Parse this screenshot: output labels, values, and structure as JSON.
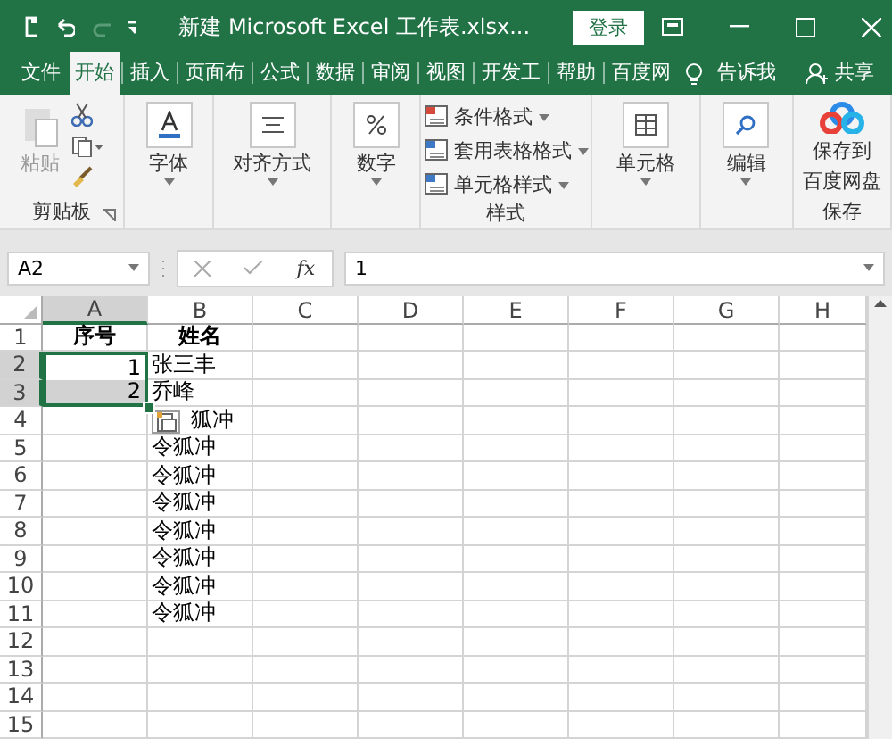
{
  "title_bar": {
    "title": "新建 Microsoft Excel 工作表.xlsx...",
    "login": "登录"
  },
  "tabs": [
    {
      "label": "文件",
      "selected": false
    },
    {
      "label": "开始",
      "selected": true
    },
    {
      "label": "插入",
      "selected": false
    },
    {
      "label": "页面布",
      "selected": false
    },
    {
      "label": "公式",
      "selected": false
    },
    {
      "label": "数据",
      "selected": false
    },
    {
      "label": "审阅",
      "selected": false
    },
    {
      "label": "视图",
      "selected": false
    },
    {
      "label": "开发工",
      "selected": false
    },
    {
      "label": "帮助",
      "selected": false
    },
    {
      "label": "百度网",
      "selected": false
    }
  ],
  "tell_me": "告诉我",
  "share": "共享",
  "ribbon": {
    "clipboard": {
      "paste": "粘贴",
      "paste_disabled": true,
      "label": "剪贴板"
    },
    "font": "字体",
    "alignment": "对齐方式",
    "number": "数字",
    "styles": {
      "items": [
        "条件格式",
        "套用表格格式",
        "单元格样式"
      ],
      "label": "样式"
    },
    "cells": "单元格",
    "editing": "编辑",
    "save": {
      "button": [
        "保存到",
        "百度网盘"
      ],
      "label": "保存"
    }
  },
  "formula_bar": {
    "name_box": "A2",
    "fx": "fx",
    "value": "1"
  },
  "columns": [
    {
      "label": "A",
      "selected": true
    },
    {
      "label": "B",
      "selected": false
    },
    {
      "label": "C",
      "selected": false
    },
    {
      "label": "D",
      "selected": false
    },
    {
      "label": "E",
      "selected": false
    },
    {
      "label": "F",
      "selected": false
    },
    {
      "label": "G",
      "selected": false
    },
    {
      "label": "H",
      "selected": false
    }
  ],
  "rows": [
    {
      "number": "1",
      "a": "序号",
      "b": "姓名",
      "selected": false
    },
    {
      "number": "2",
      "a": "1",
      "b": "张三丰",
      "selected": true
    },
    {
      "number": "3",
      "a": "2",
      "b": "乔峰",
      "selected": true
    },
    {
      "number": "4",
      "b": "狐冲",
      "selected": false
    },
    {
      "number": "5",
      "b": "令狐冲",
      "selected": false
    },
    {
      "number": "6",
      "b": "令狐冲",
      "selected": false
    },
    {
      "number": "7",
      "b": "令狐冲",
      "selected": false
    },
    {
      "number": "8",
      "b": "令狐冲",
      "selected": false
    },
    {
      "number": "9",
      "b": "令狐冲",
      "selected": false
    },
    {
      "number": "10",
      "b": "令狐冲",
      "selected": false
    },
    {
      "number": "11",
      "b": "令狐冲",
      "selected": false
    },
    {
      "number": "12",
      "selected": false
    },
    {
      "number": "13",
      "selected": false
    },
    {
      "number": "14",
      "selected": false
    },
    {
      "number": "15",
      "selected": false
    }
  ]
}
